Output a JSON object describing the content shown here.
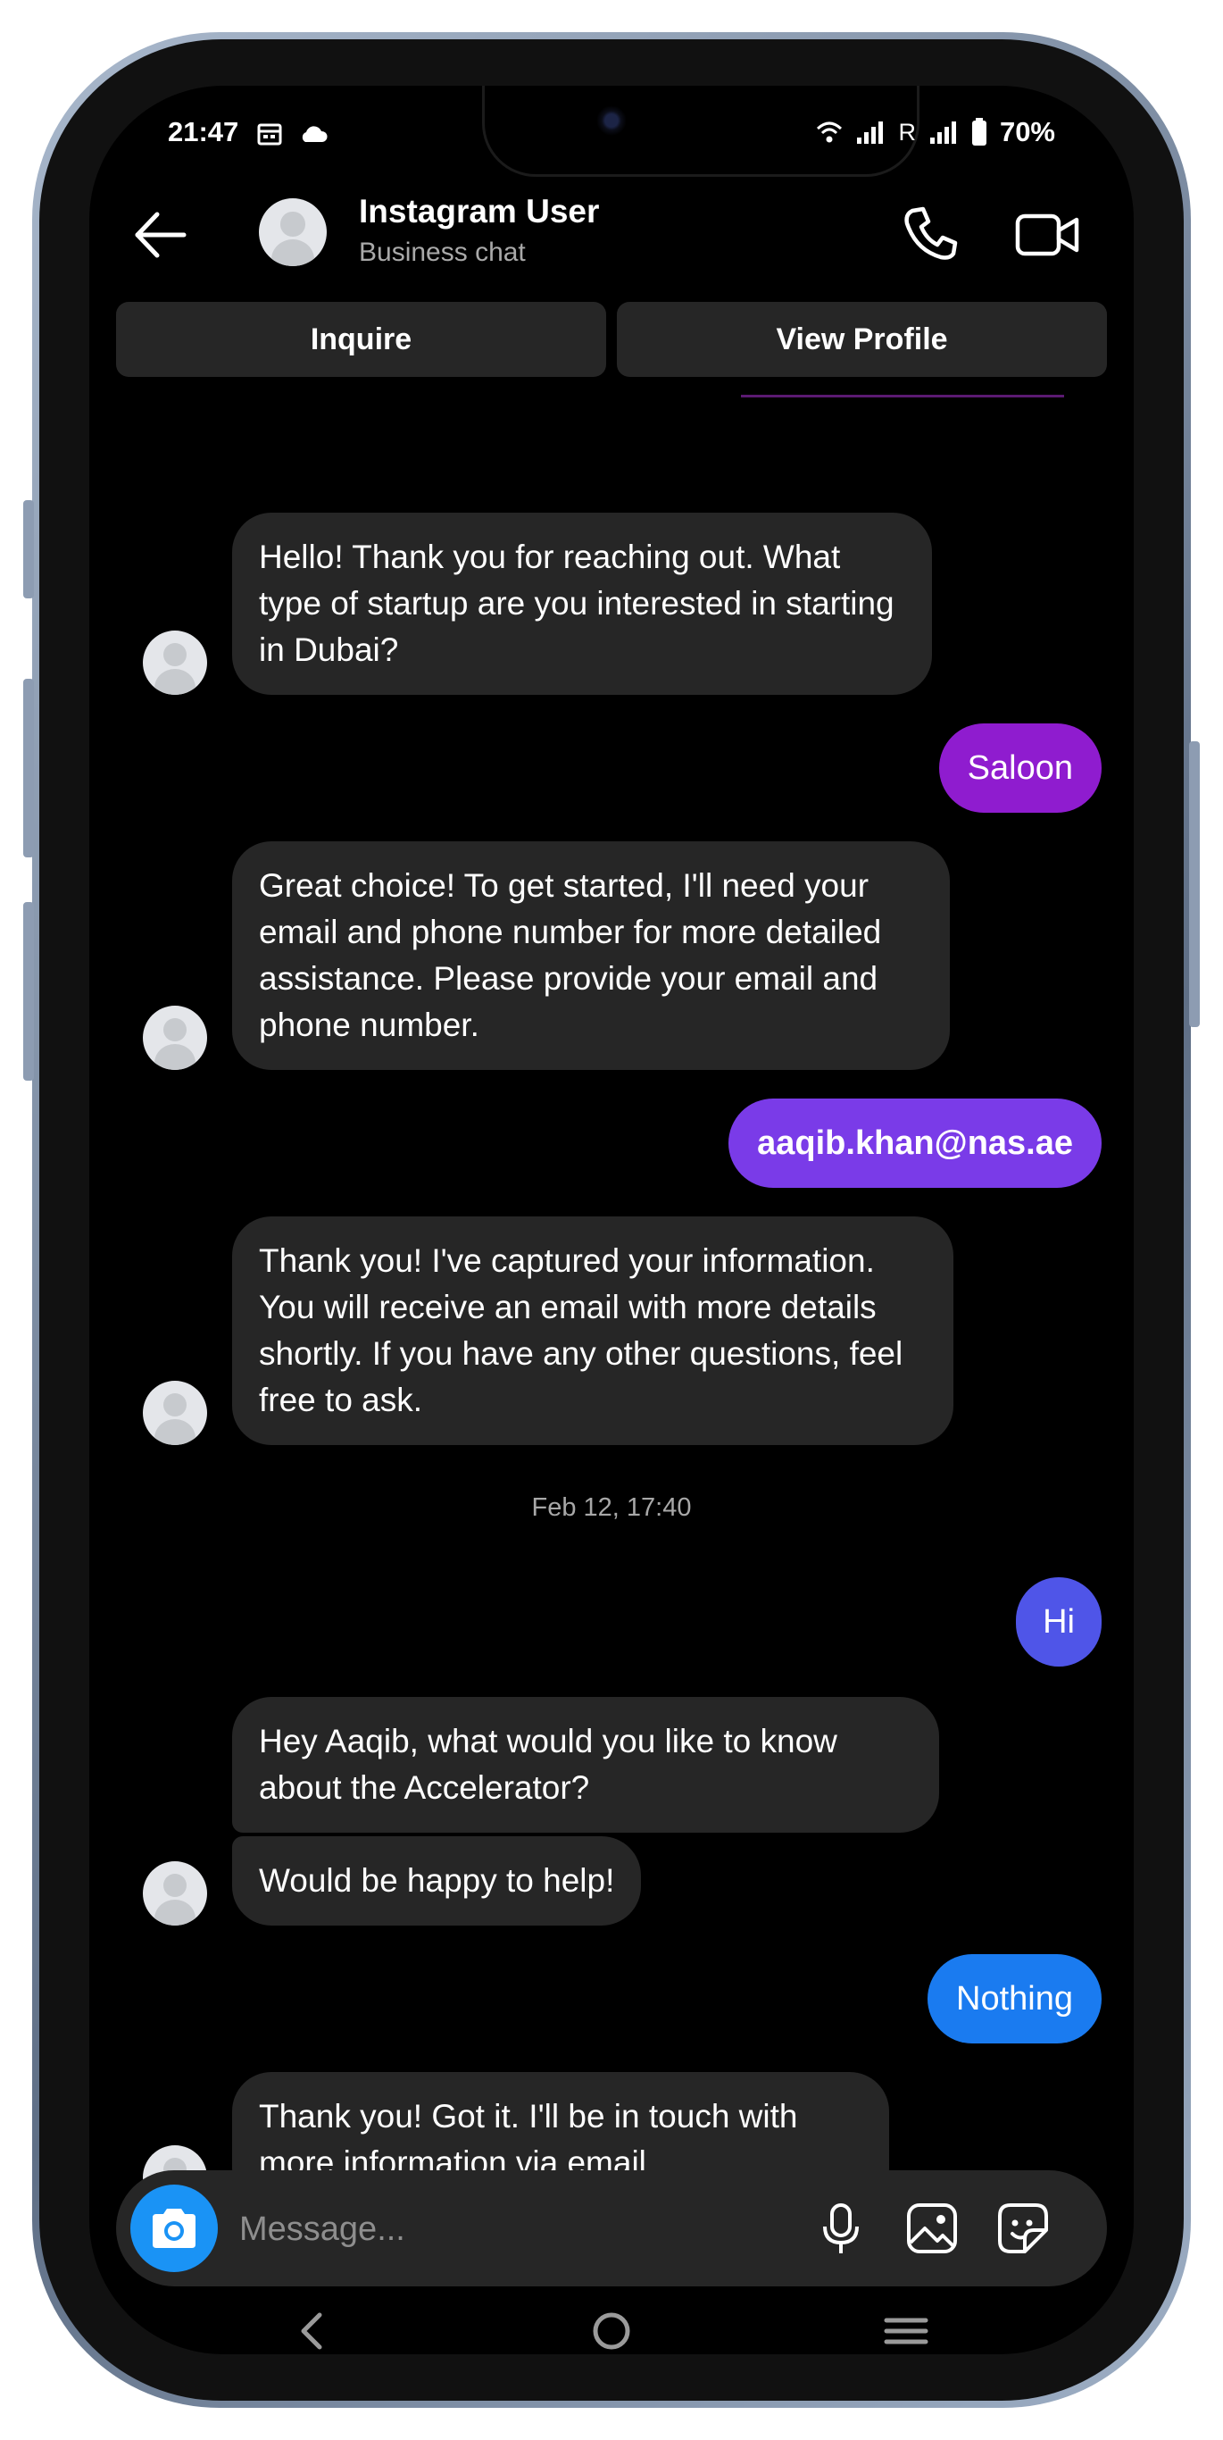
{
  "status_bar": {
    "time": "21:47",
    "left_icons": [
      "calendar-icon",
      "cloud-icon"
    ],
    "roaming": "R",
    "battery": "70%"
  },
  "header": {
    "title": "Instagram User",
    "subtitle": "Business chat"
  },
  "actions": [
    {
      "label": "Inquire"
    },
    {
      "label": "View Profile"
    }
  ],
  "messages": [
    {
      "side": "in",
      "text": "Hello! Thank you for reaching out. What type of startup are you interested in starting in Dubai?"
    },
    {
      "side": "out",
      "text": "Saloon"
    },
    {
      "side": "in",
      "text": "Great choice! To get started, I'll need your email and phone number for more detailed assistance. Please provide your email and phone number."
    },
    {
      "side": "out",
      "text": "aaqib.khan@nas.ae"
    },
    {
      "side": "in",
      "text": "Thank you! I've captured your information. You will receive an email with more details shortly. If you have any other questions, feel free to ask."
    },
    {
      "type": "timestamp",
      "text": "Feb 12, 17:40"
    },
    {
      "side": "out",
      "text": "Hi"
    },
    {
      "side": "in",
      "text": "Hey Aaqib, what would you like to know about the Accelerator?"
    },
    {
      "side": "in",
      "text": "Would be happy to help!"
    },
    {
      "side": "out",
      "text": "Nothing"
    },
    {
      "side": "in",
      "text": "Thank you! Got it. I'll be in touch with more information via email."
    }
  ],
  "composer": {
    "placeholder": "Message..."
  },
  "colors": {
    "background": "#000000",
    "incoming_bubble": "#262626",
    "outgoing_purple": "#8f1ccf",
    "outgoing_violet": "#7a3be8",
    "outgoing_indigo": "#4f55e8",
    "outgoing_blue": "#1a7bf0",
    "camera_button": "#1a93f5"
  }
}
